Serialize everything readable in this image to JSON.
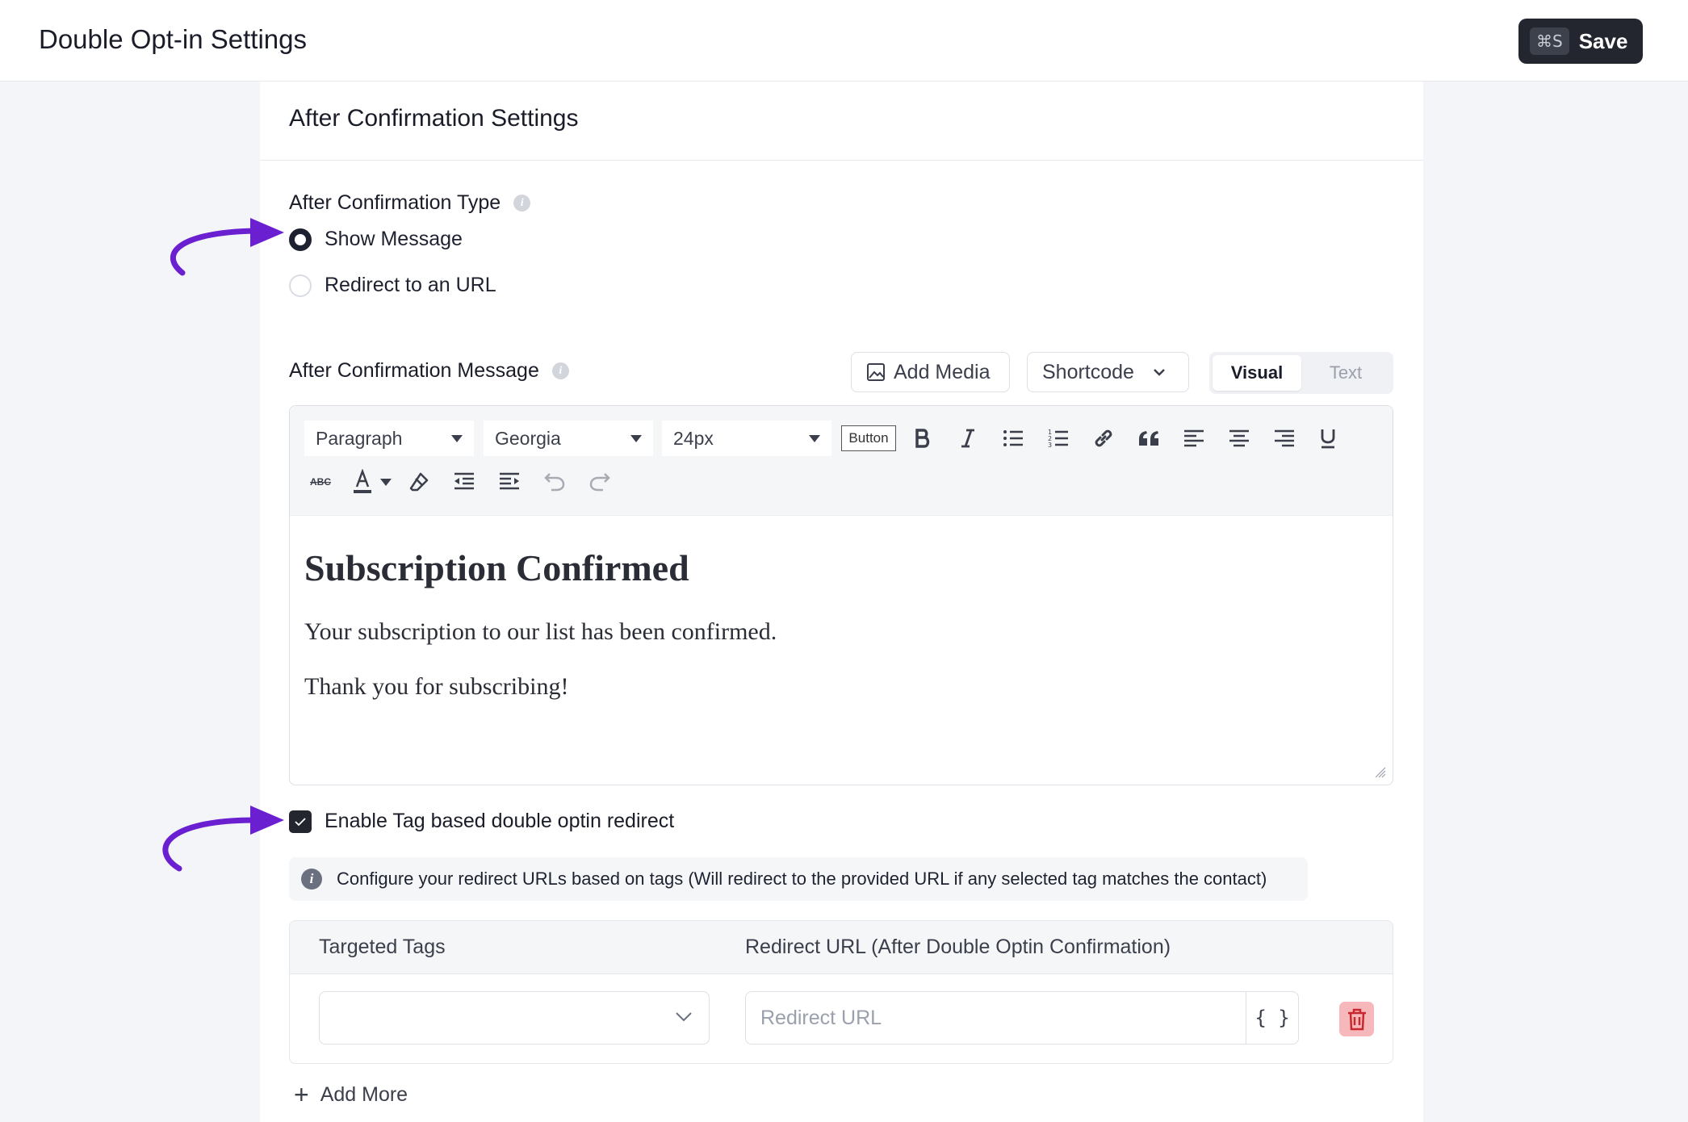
{
  "header": {
    "title": "Double Opt-in Settings",
    "save_shortcut": "⌘S",
    "save_label": "Save"
  },
  "panel": {
    "title": "After Confirmation Settings"
  },
  "confirmation_type": {
    "label": "After Confirmation Type",
    "options": [
      {
        "label": "Show Message",
        "selected": true
      },
      {
        "label": "Redirect to an URL",
        "selected": false
      }
    ]
  },
  "message": {
    "label": "After Confirmation Message",
    "add_media": "Add Media",
    "shortcode": "Shortcode",
    "tabs": [
      "Visual",
      "Text"
    ],
    "active_tab": "Visual"
  },
  "toolbar": {
    "format": "Paragraph",
    "font": "Georgia",
    "size": "24px",
    "button_label": "Button",
    "strikethrough_label": "ABC"
  },
  "content": {
    "heading": "Subscription Confirmed",
    "paragraphs": [
      "Your subscription to our list has been confirmed.",
      "Thank you for subscribing!"
    ]
  },
  "tag_redirect": {
    "label": "Enable Tag based double optin redirect",
    "checked": true,
    "notice": "Configure your redirect URLs based on tags (Will redirect to the provided URL if any selected tag matches the contact)",
    "col_tags": "Targeted Tags",
    "col_url": "Redirect URL (After Double Optin Confirmation)",
    "url_placeholder": "Redirect URL",
    "url_value": "",
    "shortcode_btn": "{ }",
    "add_more": "Add More"
  },
  "colors": {
    "accent_arrow": "#6a1fd1",
    "save_bg": "#23262f",
    "delete_bg": "#f6b8bb"
  }
}
